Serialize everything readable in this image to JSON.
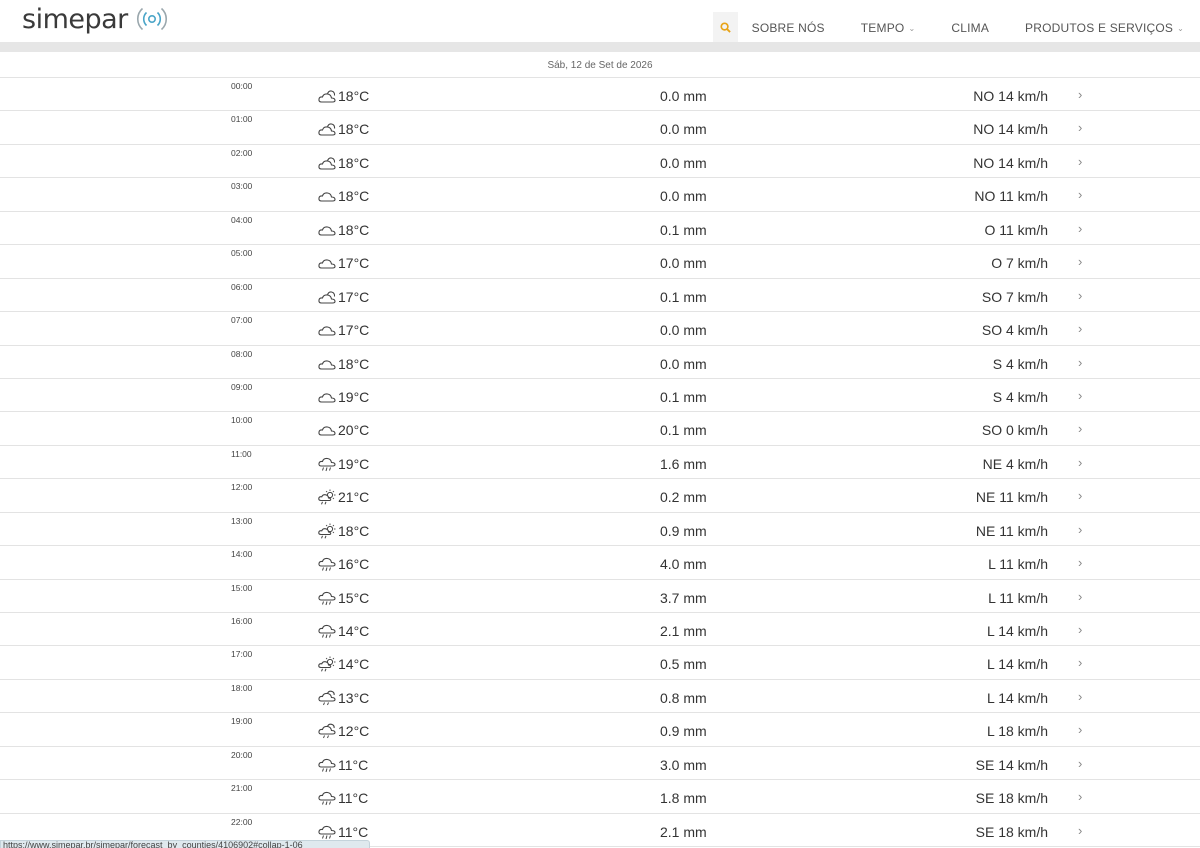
{
  "brand": {
    "name": "simepar"
  },
  "nav": {
    "search_icon": "search-icon",
    "items": [
      {
        "label": "SOBRE NÓS",
        "dropdown": false
      },
      {
        "label": "TEMPO",
        "dropdown": true
      },
      {
        "label": "CLIMA",
        "dropdown": false
      },
      {
        "label": "PRODUTOS E SERVIÇOS",
        "dropdown": true
      }
    ]
  },
  "forecast": {
    "date_label": "Sáb, 12 de Set de 2026",
    "rows": [
      {
        "time": "00:00",
        "icon": "partly-cloudy",
        "temp": "18°C",
        "rain": "0.0 mm",
        "wind": "NO 14 km/h"
      },
      {
        "time": "01:00",
        "icon": "partly-cloudy",
        "temp": "18°C",
        "rain": "0.0 mm",
        "wind": "NO 14 km/h"
      },
      {
        "time": "02:00",
        "icon": "partly-cloudy",
        "temp": "18°C",
        "rain": "0.0 mm",
        "wind": "NO 14 km/h"
      },
      {
        "time": "03:00",
        "icon": "cloudy",
        "temp": "18°C",
        "rain": "0.0 mm",
        "wind": "NO 11 km/h"
      },
      {
        "time": "04:00",
        "icon": "cloudy",
        "temp": "18°C",
        "rain": "0.1 mm",
        "wind": "O 11 km/h"
      },
      {
        "time": "05:00",
        "icon": "cloudy",
        "temp": "17°C",
        "rain": "0.0 mm",
        "wind": "O 7 km/h"
      },
      {
        "time": "06:00",
        "icon": "partly-cloudy",
        "temp": "17°C",
        "rain": "0.1 mm",
        "wind": "SO 7 km/h"
      },
      {
        "time": "07:00",
        "icon": "cloudy",
        "temp": "17°C",
        "rain": "0.0 mm",
        "wind": "SO 4 km/h"
      },
      {
        "time": "08:00",
        "icon": "cloudy",
        "temp": "18°C",
        "rain": "0.0 mm",
        "wind": "S 4 km/h"
      },
      {
        "time": "09:00",
        "icon": "cloudy",
        "temp": "19°C",
        "rain": "0.1 mm",
        "wind": "S 4 km/h"
      },
      {
        "time": "10:00",
        "icon": "cloudy",
        "temp": "20°C",
        "rain": "0.1 mm",
        "wind": "SO 0 km/h"
      },
      {
        "time": "11:00",
        "icon": "rain",
        "temp": "19°C",
        "rain": "1.6 mm",
        "wind": "NE 4 km/h"
      },
      {
        "time": "12:00",
        "icon": "sun-rain",
        "temp": "21°C",
        "rain": "0.2 mm",
        "wind": "NE 11 km/h"
      },
      {
        "time": "13:00",
        "icon": "sun-rain",
        "temp": "18°C",
        "rain": "0.9 mm",
        "wind": "NE 11 km/h"
      },
      {
        "time": "14:00",
        "icon": "rain",
        "temp": "16°C",
        "rain": "4.0 mm",
        "wind": "L 11 km/h"
      },
      {
        "time": "15:00",
        "icon": "rain",
        "temp": "15°C",
        "rain": "3.7 mm",
        "wind": "L 11 km/h"
      },
      {
        "time": "16:00",
        "icon": "rain",
        "temp": "14°C",
        "rain": "2.1 mm",
        "wind": "L 14 km/h"
      },
      {
        "time": "17:00",
        "icon": "sun-rain",
        "temp": "14°C",
        "rain": "0.5 mm",
        "wind": "L 14 km/h"
      },
      {
        "time": "18:00",
        "icon": "partly-rain",
        "temp": "13°C",
        "rain": "0.8 mm",
        "wind": "L 14 km/h"
      },
      {
        "time": "19:00",
        "icon": "partly-rain",
        "temp": "12°C",
        "rain": "0.9 mm",
        "wind": "L 18 km/h"
      },
      {
        "time": "20:00",
        "icon": "rain",
        "temp": "11°C",
        "rain": "3.0 mm",
        "wind": "SE 14 km/h"
      },
      {
        "time": "21:00",
        "icon": "rain",
        "temp": "11°C",
        "rain": "1.8 mm",
        "wind": "SE 18 km/h"
      },
      {
        "time": "22:00",
        "icon": "rain",
        "temp": "11°C",
        "rain": "2.1 mm",
        "wind": "SE 18 km/h"
      }
    ]
  },
  "statusbar": {
    "url": "https://www.simepar.br/simepar/forecast_by_counties/4106902#collap-1-06"
  },
  "colors": {
    "accent": "#f0b429",
    "band": "#e6e6e6",
    "divider": "#e3e3e3"
  }
}
